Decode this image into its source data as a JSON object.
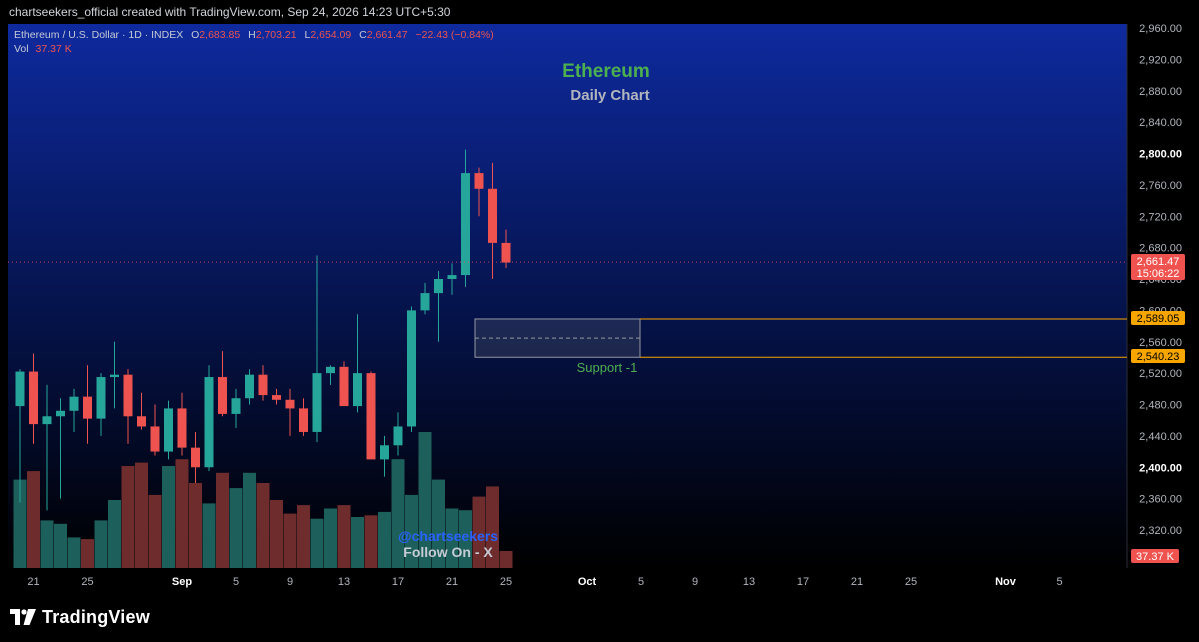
{
  "header": {
    "credit": "chartseekers_official created with TradingView.com, Sep 24, 2026 14:23 UTC+5:30"
  },
  "legend": {
    "symbol": "Ethereum / U.S. Dollar · 1D · INDEX",
    "open_label": "O",
    "open_value": "2,683.85",
    "high_label": "H",
    "high_value": "2,703.21",
    "low_label": "L",
    "low_value": "2,654.09",
    "close_label": "C",
    "close_value": "2,661.47",
    "change": "−22.43 (−0.84%)",
    "vol_label": "Vol",
    "vol_value": "37.37 K"
  },
  "annotations": {
    "title": "Ethereum",
    "subtitle": "Daily Chart",
    "support_label": "Support -1",
    "watermark_handle": "@chartseekers",
    "watermark_follow": "Follow On - X"
  },
  "price_badges": {
    "last_price": "2,661.47",
    "countdown": "15:06:22",
    "support_top": "2,589.05",
    "support_bottom": "2,540.23",
    "volume": "37.37 K"
  },
  "footer": {
    "brand": "TradingView"
  },
  "colors": {
    "up": "#26a69a",
    "down": "#ef5350",
    "vol_up": "#1d5f5a",
    "vol_down": "#6e2c2c",
    "title_green": "#4caf50",
    "support_green": "#4caf50",
    "level_orange": "#f7a600",
    "watermark_blue": "#2962ff",
    "bg_top": "#0e2a9e",
    "bg_bottom": "#000000"
  },
  "chart_data": {
    "type": "candlestick",
    "y_axis": {
      "ticks": [
        "2,960.00",
        "2,920.00",
        "2,880.00",
        "2,840.00",
        "2,800.00",
        "2,760.00",
        "2,720.00",
        "2,680.00",
        "2,640.00",
        "2,600.00",
        "2,560.00",
        "2,520.00",
        "2,480.00",
        "2,440.00",
        "2,400.00",
        "2,360.00",
        "2,320.00"
      ],
      "tick_values": [
        2960,
        2920,
        2880,
        2840,
        2800,
        2760,
        2720,
        2680,
        2640,
        2600,
        2560,
        2520,
        2480,
        2440,
        2400,
        2360,
        2320
      ],
      "bold_ticks": [
        2800,
        2400
      ],
      "range": [
        2280,
        2970
      ]
    },
    "x_axis": {
      "labels": [
        {
          "label": "21",
          "day": 1
        },
        {
          "label": "25",
          "day": 5
        },
        {
          "label": "Sep",
          "day": 12,
          "bold": true
        },
        {
          "label": "5",
          "day": 16
        },
        {
          "label": "9",
          "day": 20
        },
        {
          "label": "13",
          "day": 24
        },
        {
          "label": "17",
          "day": 28
        },
        {
          "label": "21",
          "day": 32
        },
        {
          "label": "25",
          "day": 36
        },
        {
          "label": "Oct",
          "day": 42,
          "bold": true
        },
        {
          "label": "5",
          "day": 46
        },
        {
          "label": "9",
          "day": 50
        },
        {
          "label": "13",
          "day": 54
        },
        {
          "label": "17",
          "day": 58
        },
        {
          "label": "21",
          "day": 62
        },
        {
          "label": "25",
          "day": 66
        },
        {
          "label": "Nov",
          "day": 73,
          "bold": true
        },
        {
          "label": "5",
          "day": 77
        }
      ]
    },
    "candles": [
      {
        "o": 2478,
        "h": 2525,
        "l": 2355,
        "c": 2522
      },
      {
        "o": 2522,
        "h": 2545,
        "l": 2430,
        "c": 2455
      },
      {
        "o": 2455,
        "h": 2505,
        "l": 2345,
        "c": 2465
      },
      {
        "o": 2465,
        "h": 2488,
        "l": 2360,
        "c": 2472
      },
      {
        "o": 2472,
        "h": 2500,
        "l": 2445,
        "c": 2490
      },
      {
        "o": 2490,
        "h": 2530,
        "l": 2430,
        "c": 2462
      },
      {
        "o": 2462,
        "h": 2520,
        "l": 2440,
        "c": 2515
      },
      {
        "o": 2515,
        "h": 2560,
        "l": 2475,
        "c": 2518
      },
      {
        "o": 2518,
        "h": 2525,
        "l": 2430,
        "c": 2465
      },
      {
        "o": 2465,
        "h": 2495,
        "l": 2448,
        "c": 2452
      },
      {
        "o": 2452,
        "h": 2480,
        "l": 2415,
        "c": 2420
      },
      {
        "o": 2420,
        "h": 2485,
        "l": 2410,
        "c": 2475
      },
      {
        "o": 2475,
        "h": 2495,
        "l": 2415,
        "c": 2425
      },
      {
        "o": 2425,
        "h": 2445,
        "l": 2380,
        "c": 2400
      },
      {
        "o": 2400,
        "h": 2530,
        "l": 2395,
        "c": 2515
      },
      {
        "o": 2515,
        "h": 2548,
        "l": 2465,
        "c": 2468
      },
      {
        "o": 2468,
        "h": 2500,
        "l": 2450,
        "c": 2488
      },
      {
        "o": 2488,
        "h": 2525,
        "l": 2480,
        "c": 2518
      },
      {
        "o": 2518,
        "h": 2530,
        "l": 2485,
        "c": 2492
      },
      {
        "o": 2492,
        "h": 2500,
        "l": 2480,
        "c": 2486
      },
      {
        "o": 2486,
        "h": 2500,
        "l": 2440,
        "c": 2475
      },
      {
        "o": 2475,
        "h": 2488,
        "l": 2440,
        "c": 2445
      },
      {
        "o": 2445,
        "h": 2670,
        "l": 2432,
        "c": 2520
      },
      {
        "o": 2520,
        "h": 2530,
        "l": 2505,
        "c": 2528
      },
      {
        "o": 2528,
        "h": 2535,
        "l": 2485,
        "c": 2478
      },
      {
        "o": 2478,
        "h": 2595,
        "l": 2470,
        "c": 2520
      },
      {
        "o": 2520,
        "h": 2522,
        "l": 2440,
        "c": 2410
      },
      {
        "o": 2410,
        "h": 2440,
        "l": 2388,
        "c": 2428
      },
      {
        "o": 2428,
        "h": 2470,
        "l": 2415,
        "c": 2452
      },
      {
        "o": 2452,
        "h": 2605,
        "l": 2445,
        "c": 2600
      },
      {
        "o": 2600,
        "h": 2635,
        "l": 2595,
        "c": 2622
      },
      {
        "o": 2622,
        "h": 2650,
        "l": 2560,
        "c": 2640
      },
      {
        "o": 2640,
        "h": 2660,
        "l": 2620,
        "c": 2645
      },
      {
        "o": 2645,
        "h": 2805,
        "l": 2630,
        "c": 2775
      },
      {
        "o": 2775,
        "h": 2782,
        "l": 2720,
        "c": 2755
      },
      {
        "o": 2755,
        "h": 2788,
        "l": 2640,
        "c": 2686
      },
      {
        "o": 2686,
        "h": 2703,
        "l": 2654,
        "c": 2661
      }
    ],
    "volumes": [
      0.52,
      0.57,
      0.28,
      0.26,
      0.18,
      0.17,
      0.28,
      0.4,
      0.6,
      0.62,
      0.43,
      0.6,
      0.64,
      0.5,
      0.38,
      0.56,
      0.47,
      0.56,
      0.5,
      0.4,
      0.32,
      0.37,
      0.29,
      0.35,
      0.37,
      0.3,
      0.31,
      0.33,
      0.64,
      0.43,
      0.8,
      0.52,
      0.35,
      0.34,
      0.42,
      0.48,
      0.1
    ],
    "support_zone": {
      "top": 2589.05,
      "bottom": 2540.23
    },
    "last_price": 2661.47
  }
}
